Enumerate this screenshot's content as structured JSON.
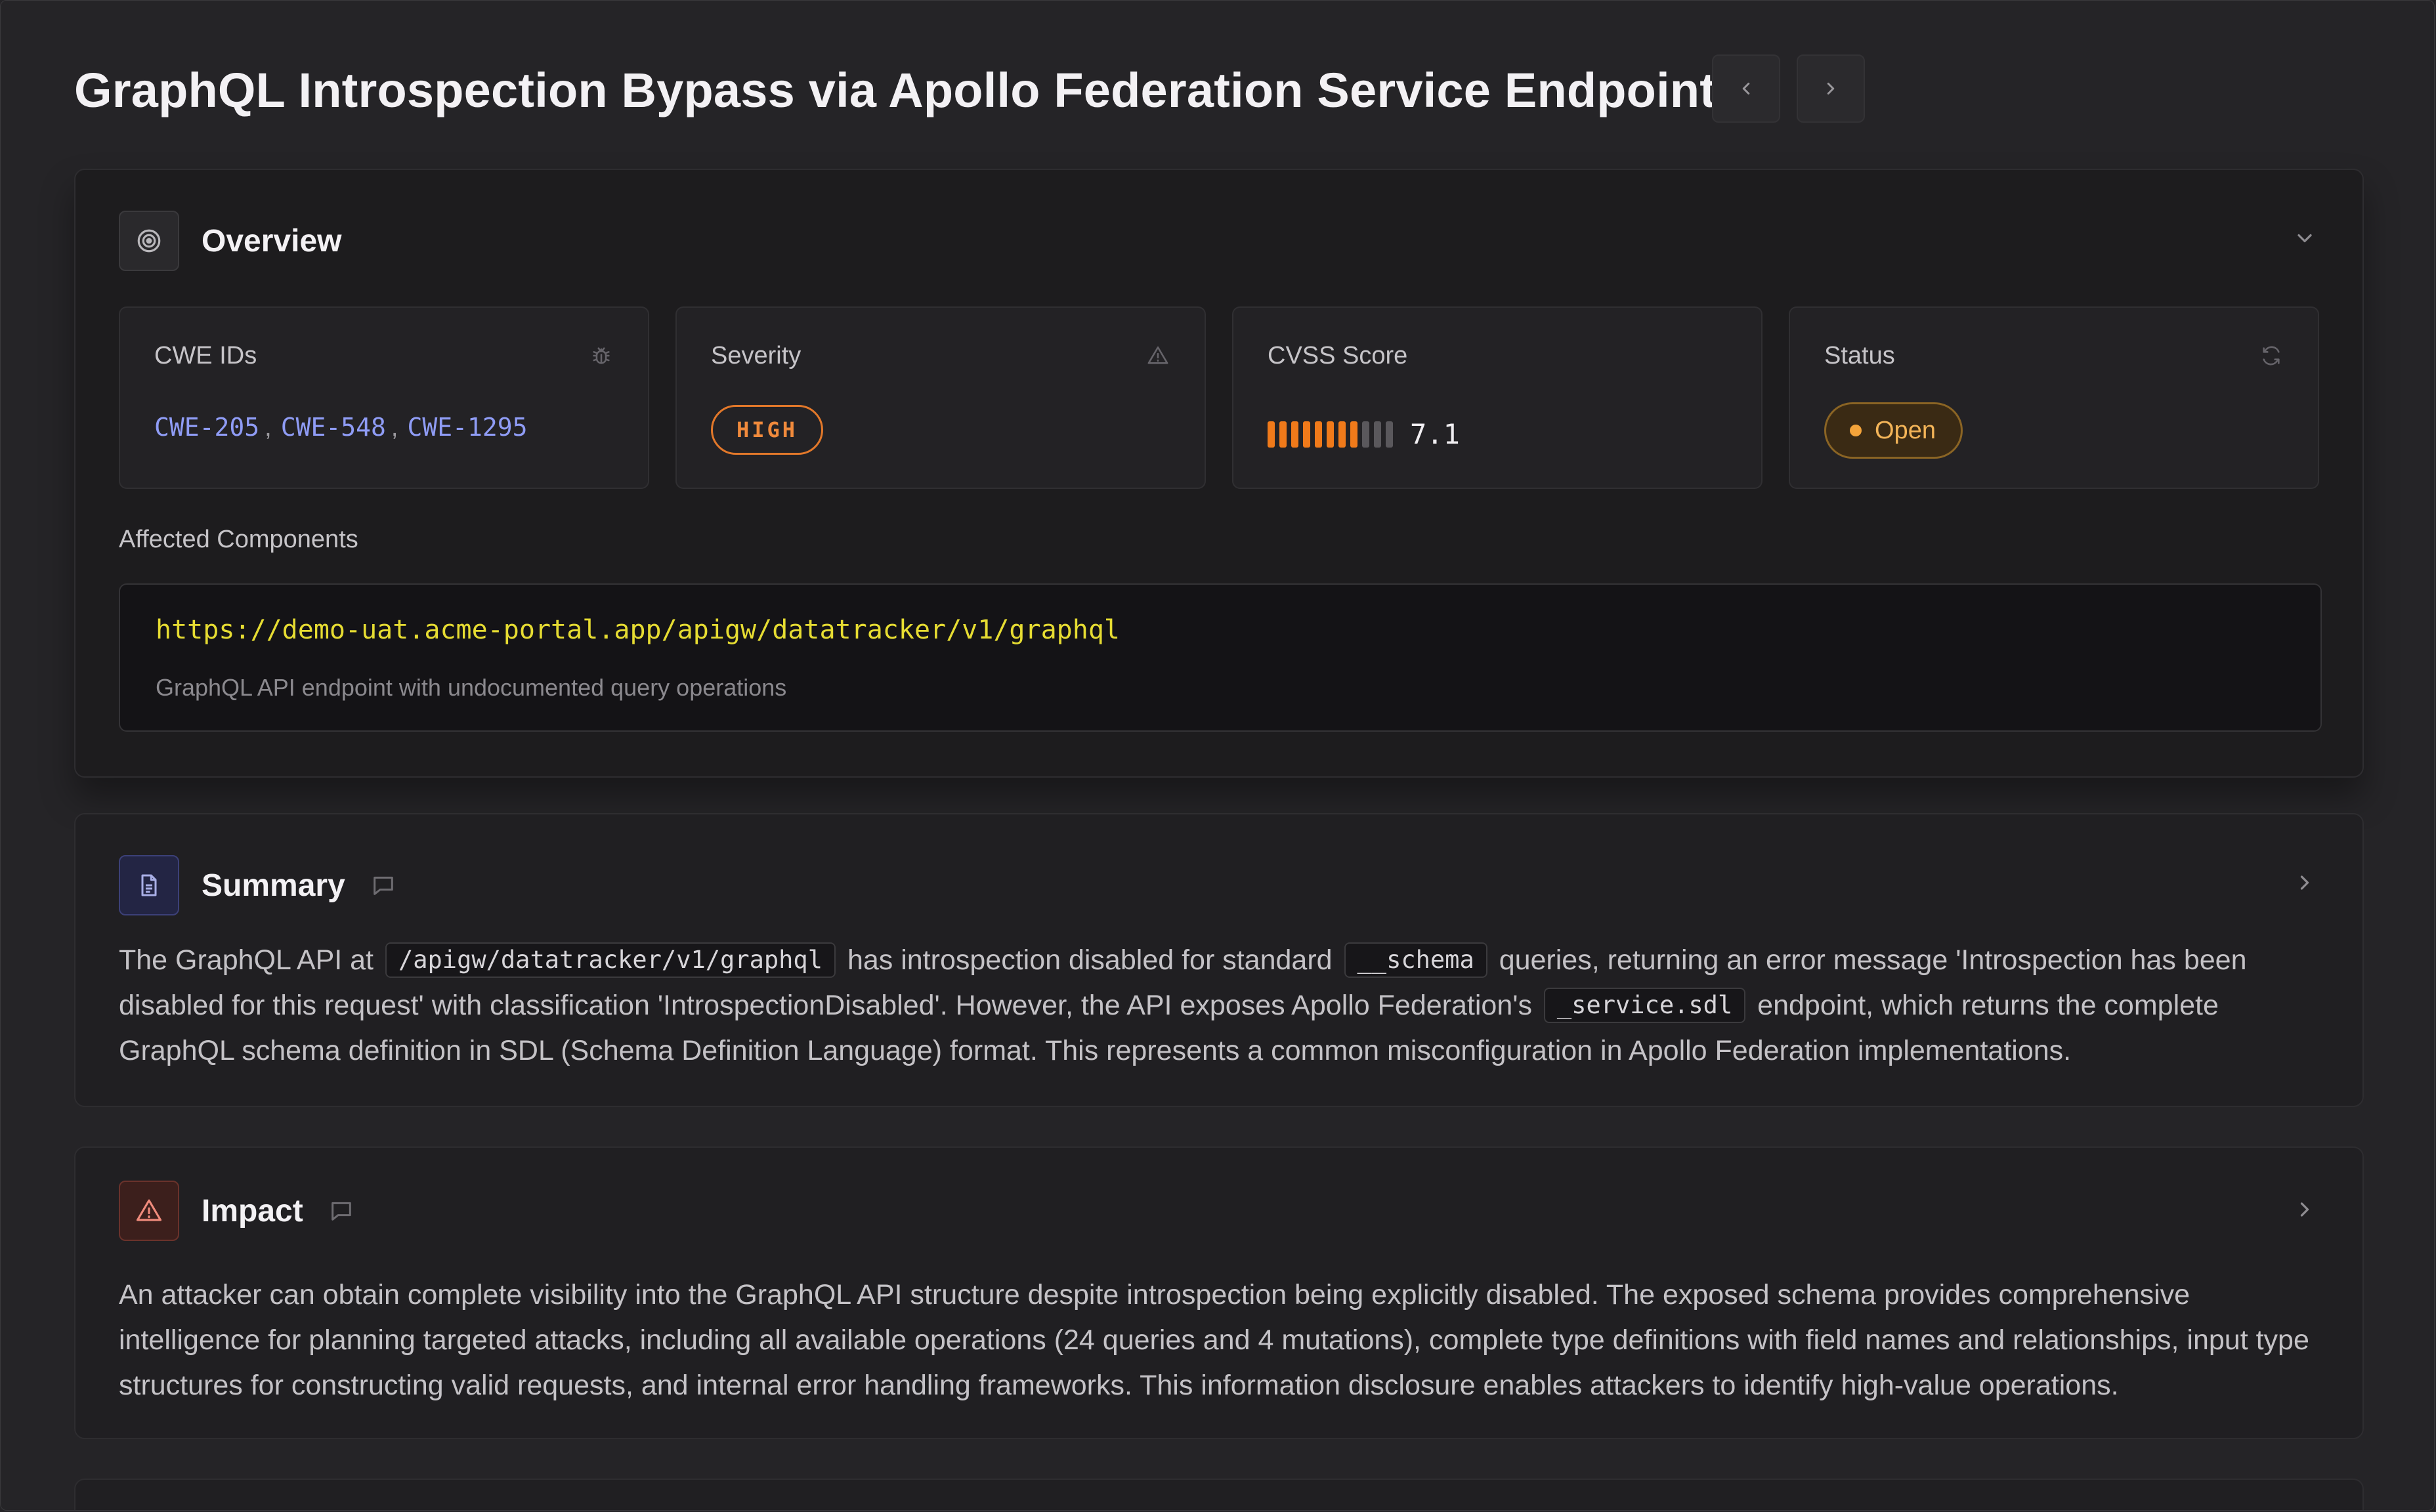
{
  "page": {
    "title": "GraphQL Introspection Bypass via Apollo Federation Service Endpoint",
    "nav": {
      "prev_icon": "chevron-left-icon",
      "next_icon": "chevron-right-icon"
    }
  },
  "overview": {
    "title": "Overview",
    "icon": "target-icon",
    "tiles": {
      "cwe": {
        "label": "CWE IDs",
        "icon": "bug-icon",
        "ids": [
          "CWE-205",
          "CWE-548",
          "CWE-1295"
        ],
        "separator": ","
      },
      "severity": {
        "label": "Severity",
        "icon": "alert-triangle-icon",
        "value": "HIGH",
        "color": "#f08a3c"
      },
      "cvss": {
        "label": "CVSS Score",
        "score": "7.1",
        "segments_filled": 8,
        "segments_total": 11,
        "fill_color": "#f07a1a",
        "empty_color": "#5a585c"
      },
      "status": {
        "label": "Status",
        "icon": "refresh-icon",
        "value": "Open",
        "color": "#f3b458"
      }
    },
    "affected": {
      "label": "Affected Components",
      "url": "https://demo-uat.acme-portal.app/apigw/datatracker/v1/graphql",
      "description": "GraphQL API endpoint with undocumented query operations"
    }
  },
  "summary": {
    "title": "Summary",
    "icon": "document-icon",
    "text": {
      "t1": "The GraphQL API at",
      "c1": "/apigw/datatracker/v1/graphql",
      "t2": "has introspection disabled for standard",
      "c2": "__schema",
      "t3": "queries, returning an error message 'Introspection has been disabled for this request' with classification 'IntrospectionDisabled'. However, the API exposes Apollo Federation's",
      "c3": "_service.sdl",
      "t4": "endpoint, which returns the complete GraphQL schema definition in SDL (Schema Definition Language) format. This represents a common misconfiguration in Apollo Federation implementations."
    }
  },
  "impact": {
    "title": "Impact",
    "icon": "warning-icon",
    "text": "An attacker can obtain complete visibility into the GraphQL API structure despite introspection being explicitly disabled. The exposed schema provides comprehensive intelligence for planning targeted attacks, including all available operations (24 queries and 4 mutations), complete type definitions with field names and relationships, input type structures for constructing valid requests, and internal error handling frameworks. This information disclosure enables attackers to identify high-value operations."
  },
  "colors": {
    "background": "#252427",
    "card": "#1d1c1e",
    "cwe_link": "#8f9cf5",
    "url": "#e6dc32"
  }
}
